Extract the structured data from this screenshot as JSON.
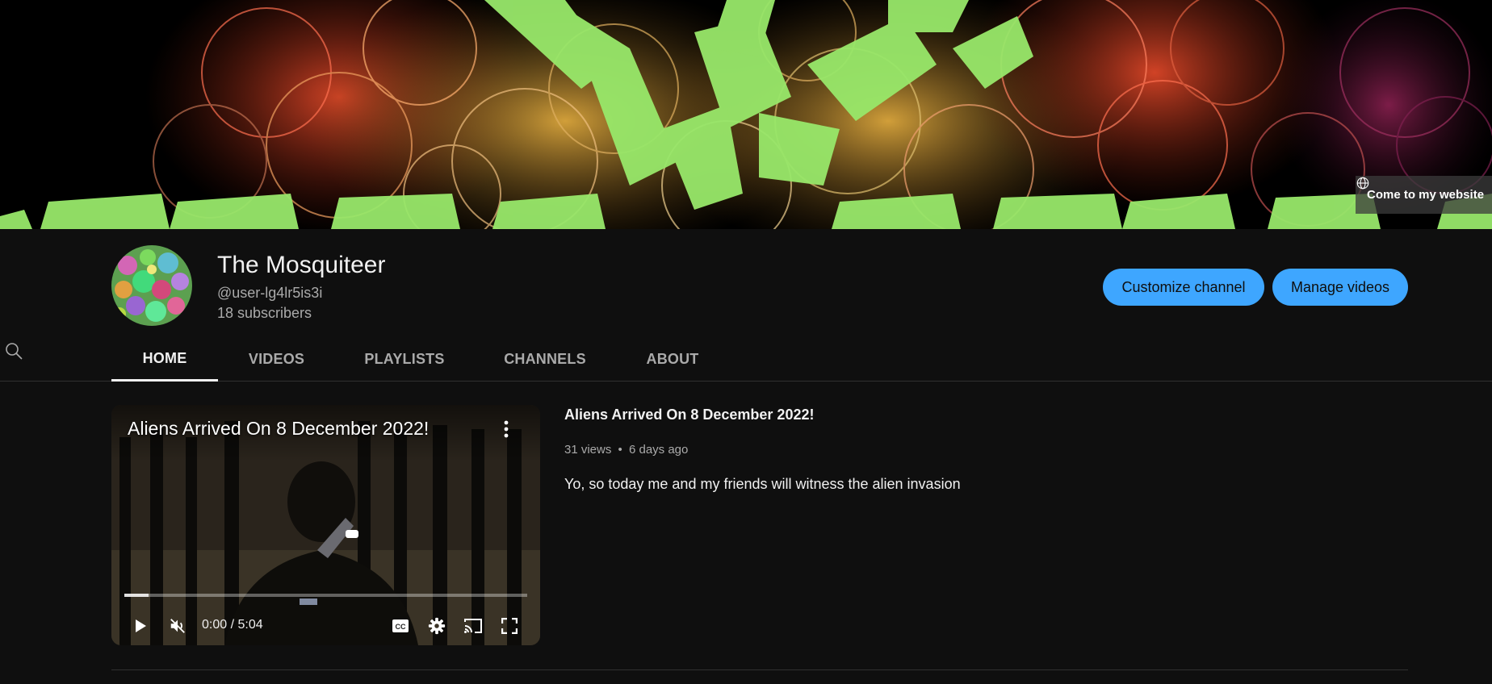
{
  "banner": {
    "link_text": "Come to my website",
    "icon": "globe-icon"
  },
  "channel": {
    "name": "The Mosquiteer",
    "handle": "@user-lg4lr5is3i",
    "subscribers": "18 subscribers",
    "customize_label": "Customize channel",
    "manage_label": "Manage videos"
  },
  "tabs": [
    {
      "label": "HOME",
      "active": true
    },
    {
      "label": "VIDEOS",
      "active": false
    },
    {
      "label": "PLAYLISTS",
      "active": false
    },
    {
      "label": "CHANNELS",
      "active": false
    },
    {
      "label": "ABOUT",
      "active": false
    }
  ],
  "tab_search_icon": "search-icon",
  "featured": {
    "player_title": "Aliens Arrived On 8 December 2022!",
    "time": "0:00 / 5:04",
    "progress": 0.06,
    "title": "Aliens Arrived On 8 December 2022!",
    "views": "31 views",
    "age": "6 days ago",
    "separator": "•",
    "description": "Yo, so today me and my friends will witness the alien invasion"
  },
  "colors": {
    "background": "#0f0f0f",
    "accent": "#3ea6ff",
    "secondary_text": "#aaaaaa"
  }
}
